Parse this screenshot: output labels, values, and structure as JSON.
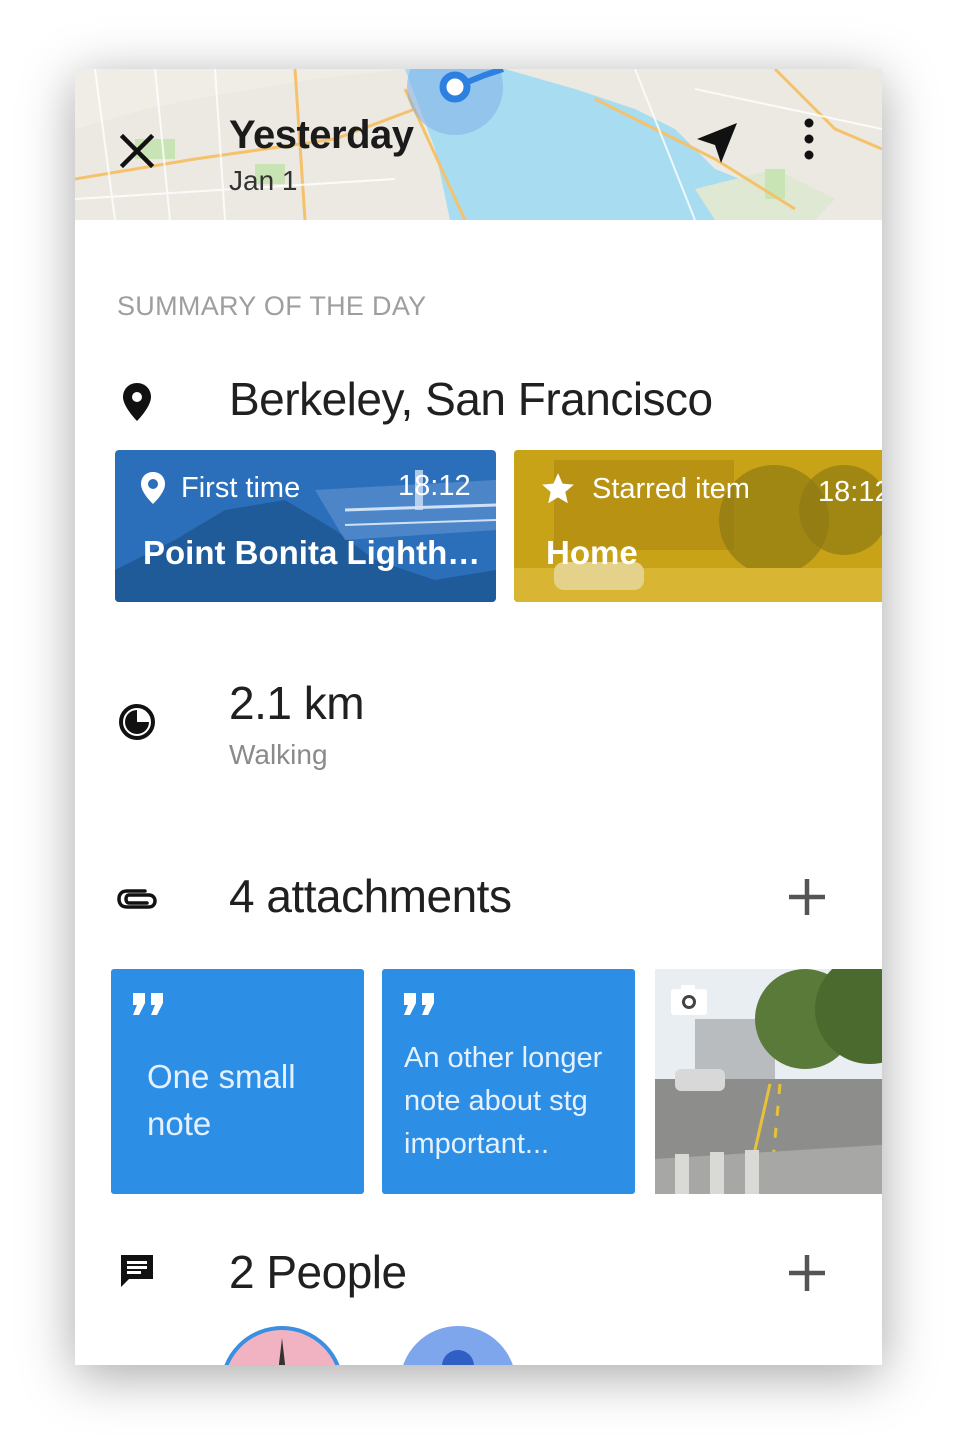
{
  "header": {
    "title": "Yesterday",
    "subtitle": "Jan 1"
  },
  "summary": {
    "section_label": "SUMMARY OF THE DAY",
    "locations": "Berkeley, San Francisco",
    "place_cards": [
      {
        "tag": "First time",
        "time": "18:12",
        "name": "Point Bonita Lighth…",
        "color": "#2b6fba",
        "icon": "location-pin-icon"
      },
      {
        "tag": "Starred item",
        "time": "18:12",
        "name": "Home",
        "color": "#c9a317",
        "icon": "star-icon"
      }
    ],
    "distance": "2.1 km",
    "activity": "Walking",
    "attachments_label": "4 attachments",
    "notes": [
      {
        "text_lines": [
          "One small",
          "note"
        ]
      },
      {
        "text_lines": [
          "An other longer",
          "note about stg",
          "important..."
        ]
      }
    ],
    "people_label": "2 People"
  },
  "colors": {
    "accent": "#2d8ee5",
    "map_water": "#a8dcf0"
  }
}
